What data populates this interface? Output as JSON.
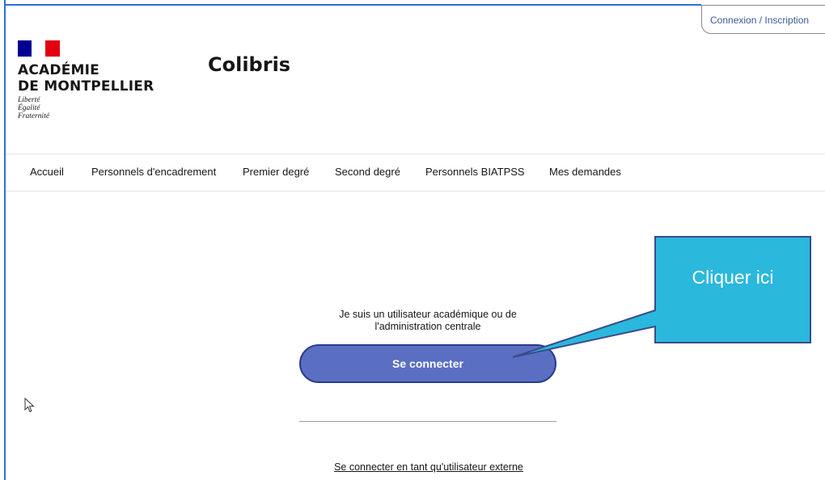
{
  "header": {
    "login_label": "Connexion / Inscription",
    "org_line1": "ACADÉMIE",
    "org_line2": "DE MONTPELLIER",
    "motto": [
      "Liberté",
      "Égalité",
      "Fraternité"
    ],
    "site_title": "Colibris"
  },
  "nav": {
    "items": [
      {
        "label": "Accueil"
      },
      {
        "label": "Personnels d'encadrement"
      },
      {
        "label": "Premier degré"
      },
      {
        "label": "Second degré"
      },
      {
        "label": "Personnels BIATPSS"
      },
      {
        "label": "Mes demandes"
      }
    ]
  },
  "main": {
    "description_line1": "Je suis un utilisateur académique ou de",
    "description_line2": "l'administration centrale",
    "connect_label": "Se connecter",
    "external_link": "Se connecter en tant qu'utilisateur externe"
  },
  "annotation": {
    "callout_text": "Cliquer ici"
  },
  "colors": {
    "accent_frame": "#2f6fd6",
    "button_fill": "#5a6fc2",
    "button_border": "#2a3b8f",
    "callout_fill": "#2ab8dc",
    "callout_border": "#3a4a8c",
    "flag_blue": "#000091",
    "flag_red": "#e1000f"
  }
}
